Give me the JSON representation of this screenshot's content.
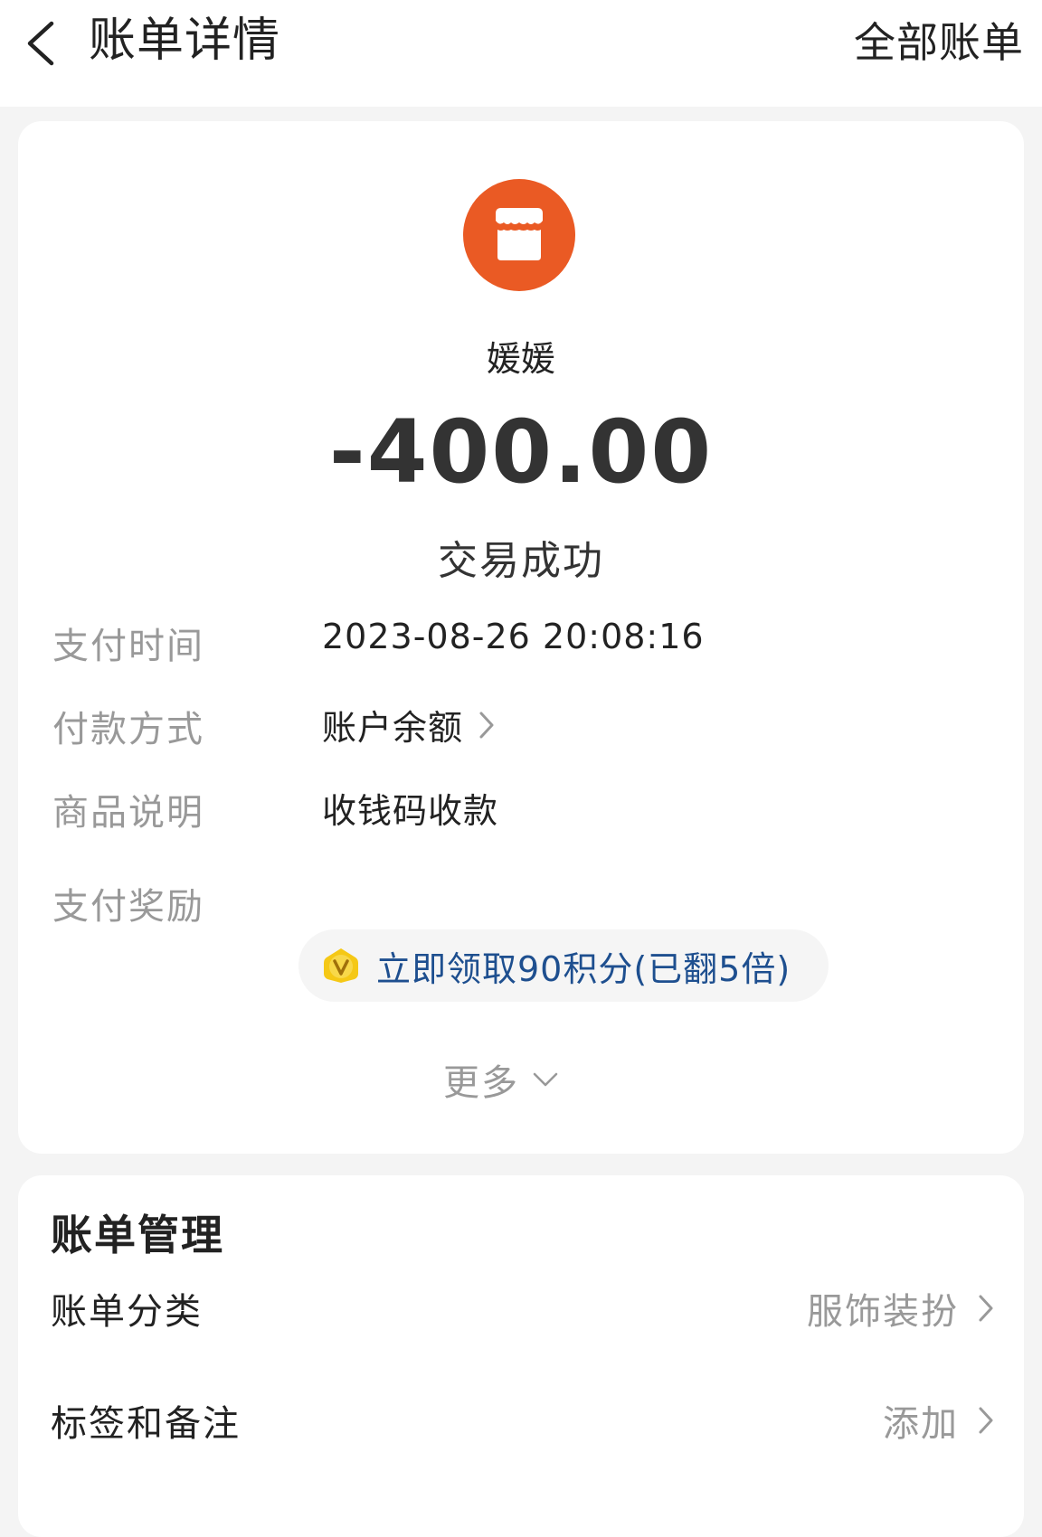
{
  "header": {
    "title": "账单详情",
    "all_bills": "全部账单"
  },
  "transaction": {
    "counterparty": "媛媛",
    "amount": "-400.00",
    "status": "交易成功",
    "shop_icon": "shop-storefront-icon",
    "brand_color": "#ea5a24"
  },
  "details": {
    "pay_time_label": "支付时间",
    "pay_time_value": "2023-08-26 20:08:16",
    "pay_method_label": "付款方式",
    "pay_method_value": "账户余额",
    "product_label": "商品说明",
    "product_value": "收钱码收款",
    "reward_label": "支付奖励",
    "reward_value": "立即领取90积分(已翻5倍)",
    "reward_color": "#1e4f8f",
    "more_label": "更多"
  },
  "manage": {
    "title": "账单管理",
    "category_label": "账单分类",
    "category_value": "服饰装扮",
    "tags_label": "标签和备注",
    "tags_value": "添加"
  }
}
